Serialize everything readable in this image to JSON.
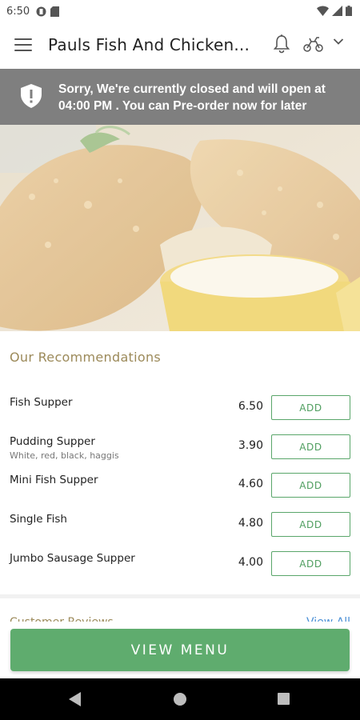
{
  "status_bar": {
    "time": "6:50"
  },
  "app_bar": {
    "title": "Pauls Fish And Chicken..."
  },
  "banner": {
    "text": "Sorry, We're currently closed and will open at 04:00 PM . You can Pre-order now for later"
  },
  "recommendations": {
    "title": "Our Recommendations",
    "add_label": "ADD",
    "items": [
      {
        "name": "Fish Supper",
        "price": "6.50",
        "desc": ""
      },
      {
        "name": "Pudding Supper",
        "price": "3.90",
        "desc": "White, red, black, haggis"
      },
      {
        "name": "Mini Fish Supper",
        "price": "4.60",
        "desc": ""
      },
      {
        "name": "Single Fish",
        "price": "4.80",
        "desc": ""
      },
      {
        "name": "Jumbo Sausage Supper",
        "price": "4.00",
        "desc": ""
      }
    ]
  },
  "reviews": {
    "title": "Customer Reviews",
    "view_all": "View All"
  },
  "footer": {
    "view_menu_label": "VIEW MENU"
  },
  "colors": {
    "accent_green": "#5fac6e",
    "banner_gray": "#7f7f7f",
    "section_title": "#9c8a5a"
  }
}
